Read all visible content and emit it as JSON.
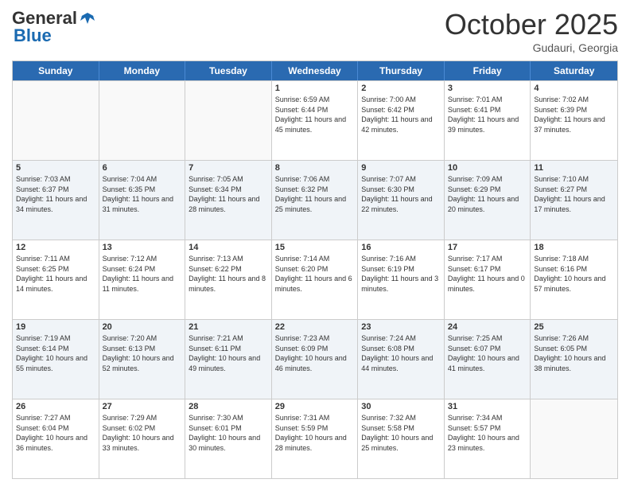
{
  "header": {
    "logo_general": "General",
    "logo_blue": "Blue",
    "month_title": "October 2025",
    "location": "Gudauri, Georgia"
  },
  "weekdays": [
    "Sunday",
    "Monday",
    "Tuesday",
    "Wednesday",
    "Thursday",
    "Friday",
    "Saturday"
  ],
  "rows": [
    {
      "cells": [
        {
          "day": "",
          "sunrise": "",
          "sunset": "",
          "daylight": "",
          "empty": true
        },
        {
          "day": "",
          "sunrise": "",
          "sunset": "",
          "daylight": "",
          "empty": true
        },
        {
          "day": "",
          "sunrise": "",
          "sunset": "",
          "daylight": "",
          "empty": true
        },
        {
          "day": "1",
          "sunrise": "Sunrise: 6:59 AM",
          "sunset": "Sunset: 6:44 PM",
          "daylight": "Daylight: 11 hours and 45 minutes.",
          "empty": false
        },
        {
          "day": "2",
          "sunrise": "Sunrise: 7:00 AM",
          "sunset": "Sunset: 6:42 PM",
          "daylight": "Daylight: 11 hours and 42 minutes.",
          "empty": false
        },
        {
          "day": "3",
          "sunrise": "Sunrise: 7:01 AM",
          "sunset": "Sunset: 6:41 PM",
          "daylight": "Daylight: 11 hours and 39 minutes.",
          "empty": false
        },
        {
          "day": "4",
          "sunrise": "Sunrise: 7:02 AM",
          "sunset": "Sunset: 6:39 PM",
          "daylight": "Daylight: 11 hours and 37 minutes.",
          "empty": false
        }
      ]
    },
    {
      "cells": [
        {
          "day": "5",
          "sunrise": "Sunrise: 7:03 AM",
          "sunset": "Sunset: 6:37 PM",
          "daylight": "Daylight: 11 hours and 34 minutes.",
          "empty": false
        },
        {
          "day": "6",
          "sunrise": "Sunrise: 7:04 AM",
          "sunset": "Sunset: 6:35 PM",
          "daylight": "Daylight: 11 hours and 31 minutes.",
          "empty": false
        },
        {
          "day": "7",
          "sunrise": "Sunrise: 7:05 AM",
          "sunset": "Sunset: 6:34 PM",
          "daylight": "Daylight: 11 hours and 28 minutes.",
          "empty": false
        },
        {
          "day": "8",
          "sunrise": "Sunrise: 7:06 AM",
          "sunset": "Sunset: 6:32 PM",
          "daylight": "Daylight: 11 hours and 25 minutes.",
          "empty": false
        },
        {
          "day": "9",
          "sunrise": "Sunrise: 7:07 AM",
          "sunset": "Sunset: 6:30 PM",
          "daylight": "Daylight: 11 hours and 22 minutes.",
          "empty": false
        },
        {
          "day": "10",
          "sunrise": "Sunrise: 7:09 AM",
          "sunset": "Sunset: 6:29 PM",
          "daylight": "Daylight: 11 hours and 20 minutes.",
          "empty": false
        },
        {
          "day": "11",
          "sunrise": "Sunrise: 7:10 AM",
          "sunset": "Sunset: 6:27 PM",
          "daylight": "Daylight: 11 hours and 17 minutes.",
          "empty": false
        }
      ]
    },
    {
      "cells": [
        {
          "day": "12",
          "sunrise": "Sunrise: 7:11 AM",
          "sunset": "Sunset: 6:25 PM",
          "daylight": "Daylight: 11 hours and 14 minutes.",
          "empty": false
        },
        {
          "day": "13",
          "sunrise": "Sunrise: 7:12 AM",
          "sunset": "Sunset: 6:24 PM",
          "daylight": "Daylight: 11 hours and 11 minutes.",
          "empty": false
        },
        {
          "day": "14",
          "sunrise": "Sunrise: 7:13 AM",
          "sunset": "Sunset: 6:22 PM",
          "daylight": "Daylight: 11 hours and 8 minutes.",
          "empty": false
        },
        {
          "day": "15",
          "sunrise": "Sunrise: 7:14 AM",
          "sunset": "Sunset: 6:20 PM",
          "daylight": "Daylight: 11 hours and 6 minutes.",
          "empty": false
        },
        {
          "day": "16",
          "sunrise": "Sunrise: 7:16 AM",
          "sunset": "Sunset: 6:19 PM",
          "daylight": "Daylight: 11 hours and 3 minutes.",
          "empty": false
        },
        {
          "day": "17",
          "sunrise": "Sunrise: 7:17 AM",
          "sunset": "Sunset: 6:17 PM",
          "daylight": "Daylight: 11 hours and 0 minutes.",
          "empty": false
        },
        {
          "day": "18",
          "sunrise": "Sunrise: 7:18 AM",
          "sunset": "Sunset: 6:16 PM",
          "daylight": "Daylight: 10 hours and 57 minutes.",
          "empty": false
        }
      ]
    },
    {
      "cells": [
        {
          "day": "19",
          "sunrise": "Sunrise: 7:19 AM",
          "sunset": "Sunset: 6:14 PM",
          "daylight": "Daylight: 10 hours and 55 minutes.",
          "empty": false
        },
        {
          "day": "20",
          "sunrise": "Sunrise: 7:20 AM",
          "sunset": "Sunset: 6:13 PM",
          "daylight": "Daylight: 10 hours and 52 minutes.",
          "empty": false
        },
        {
          "day": "21",
          "sunrise": "Sunrise: 7:21 AM",
          "sunset": "Sunset: 6:11 PM",
          "daylight": "Daylight: 10 hours and 49 minutes.",
          "empty": false
        },
        {
          "day": "22",
          "sunrise": "Sunrise: 7:23 AM",
          "sunset": "Sunset: 6:09 PM",
          "daylight": "Daylight: 10 hours and 46 minutes.",
          "empty": false
        },
        {
          "day": "23",
          "sunrise": "Sunrise: 7:24 AM",
          "sunset": "Sunset: 6:08 PM",
          "daylight": "Daylight: 10 hours and 44 minutes.",
          "empty": false
        },
        {
          "day": "24",
          "sunrise": "Sunrise: 7:25 AM",
          "sunset": "Sunset: 6:07 PM",
          "daylight": "Daylight: 10 hours and 41 minutes.",
          "empty": false
        },
        {
          "day": "25",
          "sunrise": "Sunrise: 7:26 AM",
          "sunset": "Sunset: 6:05 PM",
          "daylight": "Daylight: 10 hours and 38 minutes.",
          "empty": false
        }
      ]
    },
    {
      "cells": [
        {
          "day": "26",
          "sunrise": "Sunrise: 7:27 AM",
          "sunset": "Sunset: 6:04 PM",
          "daylight": "Daylight: 10 hours and 36 minutes.",
          "empty": false
        },
        {
          "day": "27",
          "sunrise": "Sunrise: 7:29 AM",
          "sunset": "Sunset: 6:02 PM",
          "daylight": "Daylight: 10 hours and 33 minutes.",
          "empty": false
        },
        {
          "day": "28",
          "sunrise": "Sunrise: 7:30 AM",
          "sunset": "Sunset: 6:01 PM",
          "daylight": "Daylight: 10 hours and 30 minutes.",
          "empty": false
        },
        {
          "day": "29",
          "sunrise": "Sunrise: 7:31 AM",
          "sunset": "Sunset: 5:59 PM",
          "daylight": "Daylight: 10 hours and 28 minutes.",
          "empty": false
        },
        {
          "day": "30",
          "sunrise": "Sunrise: 7:32 AM",
          "sunset": "Sunset: 5:58 PM",
          "daylight": "Daylight: 10 hours and 25 minutes.",
          "empty": false
        },
        {
          "day": "31",
          "sunrise": "Sunrise: 7:34 AM",
          "sunset": "Sunset: 5:57 PM",
          "daylight": "Daylight: 10 hours and 23 minutes.",
          "empty": false
        },
        {
          "day": "",
          "sunrise": "",
          "sunset": "",
          "daylight": "",
          "empty": true
        }
      ]
    }
  ]
}
